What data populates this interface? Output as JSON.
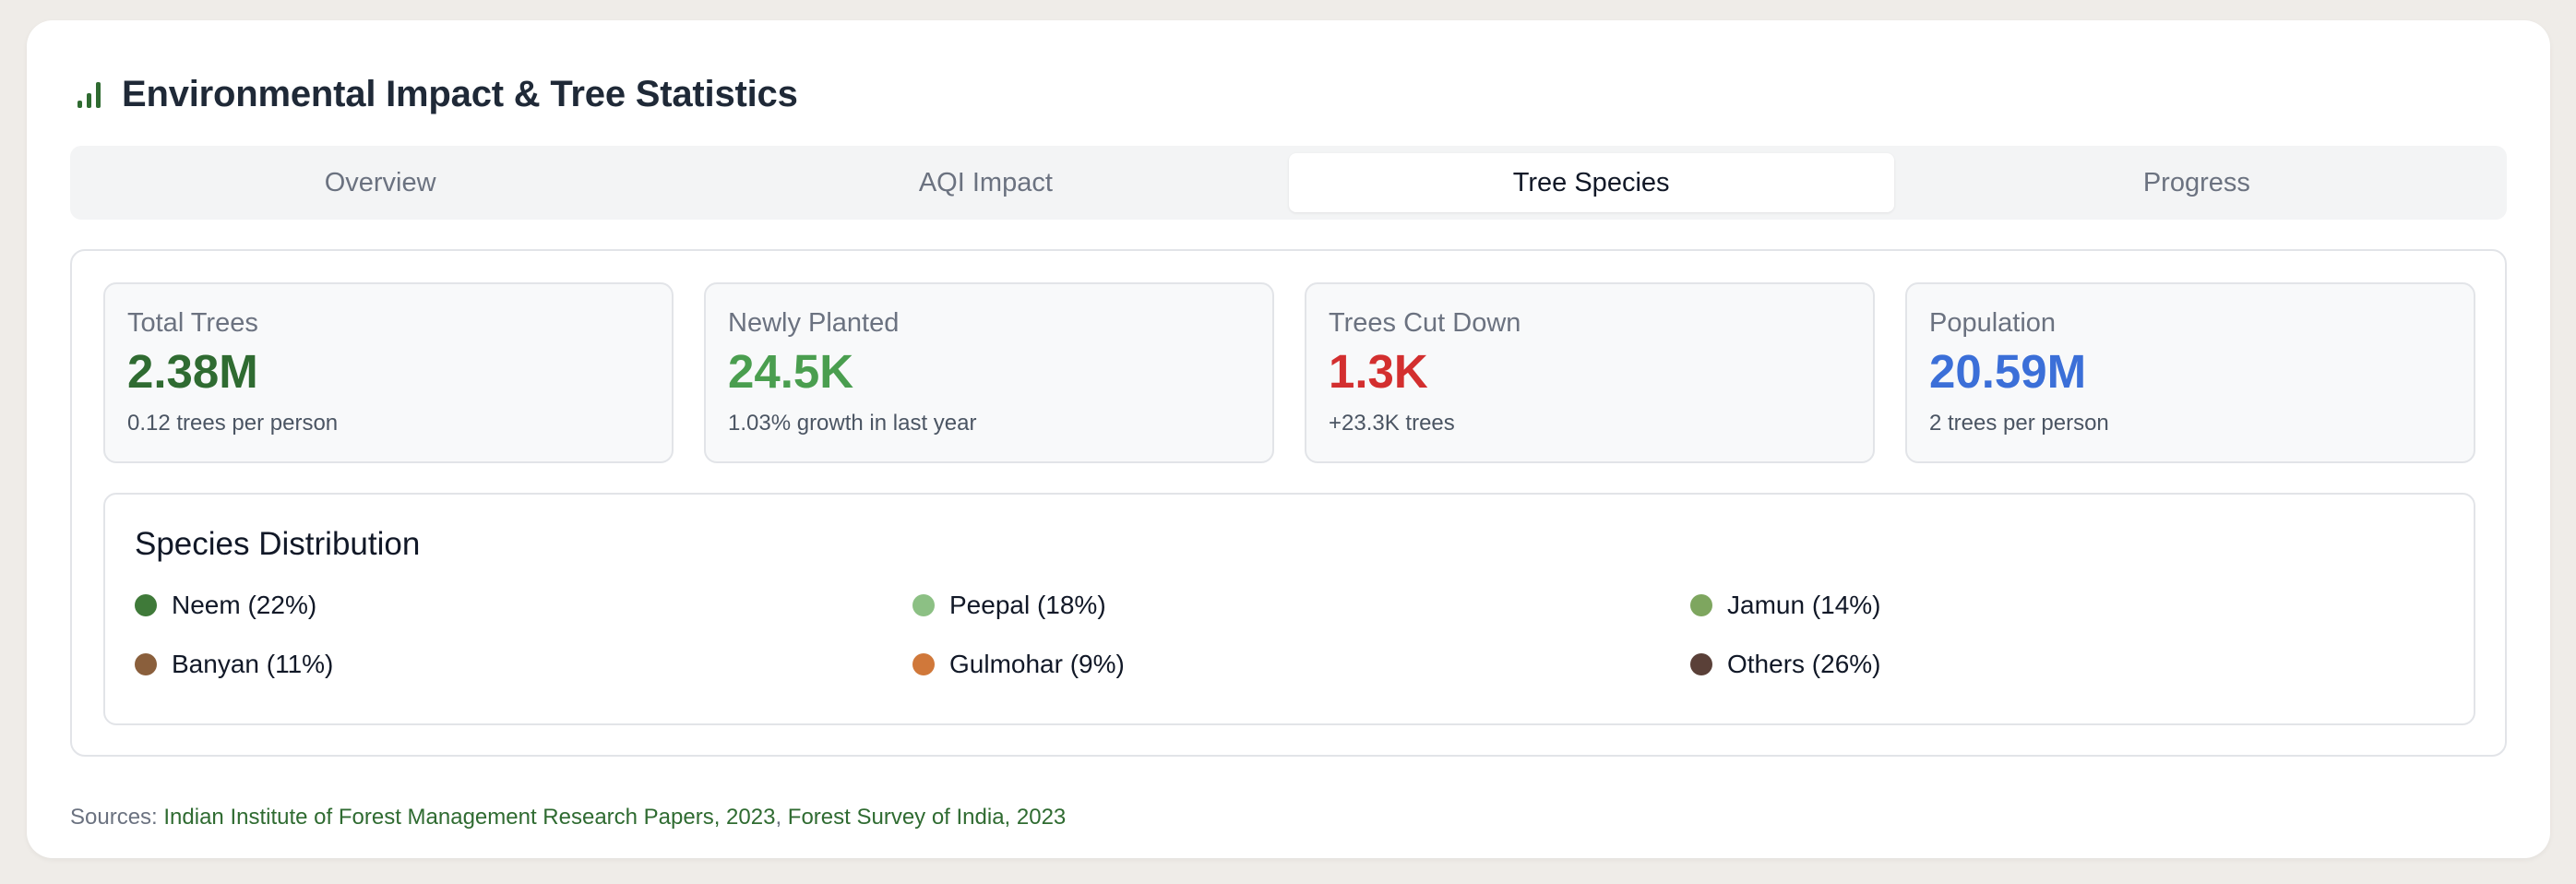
{
  "header": {
    "title": "Environmental Impact & Tree Statistics",
    "icon": "bar-chart-icon"
  },
  "tabs": [
    {
      "label": "Overview",
      "active": false
    },
    {
      "label": "AQI Impact",
      "active": false
    },
    {
      "label": "Tree Species",
      "active": true
    },
    {
      "label": "Progress",
      "active": false
    }
  ],
  "stats": [
    {
      "label": "Total Trees",
      "value": "2.38M",
      "sub": "0.12 trees per person",
      "color": "#2f6b31"
    },
    {
      "label": "Newly Planted",
      "value": "24.5K",
      "sub": "1.03% growth in last year",
      "color": "#4a9e4f"
    },
    {
      "label": "Trees Cut Down",
      "value": "1.3K",
      "sub": "+23.3K trees",
      "color": "#d32f2f"
    },
    {
      "label": "Population",
      "value": "20.59M",
      "sub": "2 trees per person",
      "color": "#3b6fd8"
    }
  ],
  "species": {
    "title": "Species Distribution",
    "items": [
      {
        "label": "Neem (22%)",
        "color": "#3f7a39"
      },
      {
        "label": "Peepal (18%)",
        "color": "#8cc084"
      },
      {
        "label": "Jamun (14%)",
        "color": "#7ea65f"
      },
      {
        "label": "Banyan (11%)",
        "color": "#8a5f3c"
      },
      {
        "label": "Gulmohar (9%)",
        "color": "#d0783a"
      },
      {
        "label": "Others (26%)",
        "color": "#5a4038"
      }
    ]
  },
  "sources": {
    "prefix": "Sources:",
    "links": [
      "Indian Institute of Forest Management Research Papers, 2023",
      "Forest Survey of India, 2023"
    ],
    "separator": ","
  }
}
